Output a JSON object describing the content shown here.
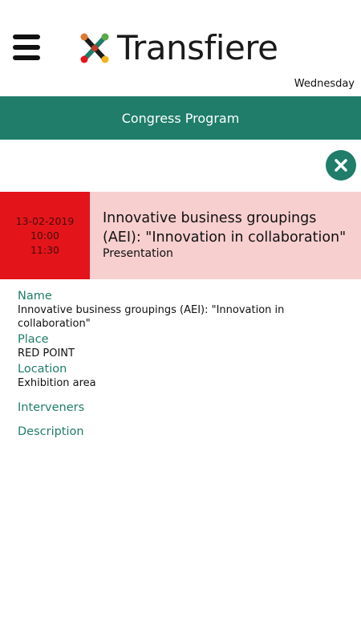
{
  "header": {
    "menu_icon": "hamburger-menu-icon",
    "brand_name": "Transfiere",
    "day_label": "Wednesday"
  },
  "section": {
    "title": "Congress Program"
  },
  "close_icon": "close-icon",
  "colors": {
    "accent": "#1f7d6a",
    "time_block": "#e3151a",
    "event_bg": "#f8cfcf"
  },
  "event": {
    "date": "13-02-2019",
    "start_time": "10:00",
    "end_time": "11:30",
    "title": "Innovative business groupings (AEI): \"Innovation in collaboration\"",
    "type": "Presentation"
  },
  "details": {
    "name_label": "Name",
    "name_value": "Innovative business groupings (AEI): \"Innovation in collaboration\"",
    "place_label": "Place",
    "place_value": "RED POINT",
    "location_label": "Location",
    "location_value": "Exhibition area",
    "interveners_label": "Interveners",
    "description_label": "Description"
  }
}
